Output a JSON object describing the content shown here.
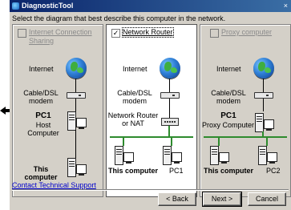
{
  "window": {
    "title": "DiagnosticTool",
    "close_glyph": "×"
  },
  "instruction": "Select the diagram that best describe this computer in the network.",
  "panels": {
    "internet_connection_sharing": {
      "option_label": "Internet Connection Sharing",
      "checked": false,
      "enabled": false,
      "labels": {
        "internet": "Internet",
        "modem_line1": "Cable/DSL",
        "modem_line2": "modem",
        "host_line1": "PC1",
        "host_line2": "Host",
        "host_line3": "Computer",
        "this_line1": "This",
        "this_line2": "computer"
      }
    },
    "network_router": {
      "option_label": "Network Router",
      "checked": true,
      "check_glyph": "✓",
      "enabled": true,
      "labels": {
        "internet": "Internet",
        "modem_line1": "Cable/DSL",
        "modem_line2": "modem",
        "router_line1": "Network Router",
        "router_line2": "or NAT",
        "this_computer": "This computer",
        "pc1": "PC1"
      }
    },
    "proxy_computer": {
      "option_label": "Proxy computer",
      "checked": false,
      "enabled": false,
      "labels": {
        "internet": "Internet",
        "modem_line1": "Cable/DSL",
        "modem_line2": "modem",
        "proxy_line1": "PC1",
        "proxy_line2": "Proxy Computer",
        "this_computer": "This computer",
        "pc2": "PC2"
      }
    }
  },
  "support_link": "Contact Technical Support",
  "buttons": {
    "back": "< Back",
    "next": "Next >",
    "cancel": "Cancel"
  },
  "colors": {
    "title_bar": "#0a246a",
    "dialog_bg": "#d4d0c8",
    "link": "#0000cc",
    "lan_line": "#2e8b2e"
  }
}
